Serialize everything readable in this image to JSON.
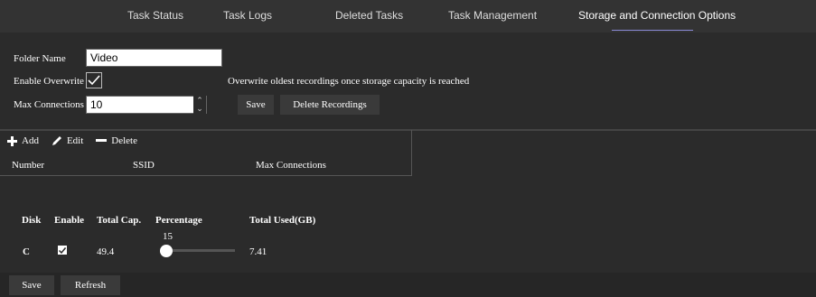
{
  "nav": {
    "tabs": [
      {
        "label": "Task Status"
      },
      {
        "label": "Task Logs"
      },
      {
        "label": "Deleted Tasks"
      },
      {
        "label": "Task Management"
      },
      {
        "label": "Storage and Connection Options",
        "active": true
      }
    ]
  },
  "settings": {
    "folder_name_label": "Folder Name",
    "folder_name_value": "Video",
    "enable_overwrite_label": "Enable Overwrite",
    "enable_overwrite_checked": true,
    "overwrite_note": "Overwrite oldest recordings once storage capacity is reached",
    "max_connections_label": "Max Connections",
    "max_connections_value": "10",
    "save_label": "Save",
    "delete_recordings_label": "Delete Recordings"
  },
  "connections_table": {
    "toolbar": {
      "add": "Add",
      "edit": "Edit",
      "delete": "Delete"
    },
    "headers": [
      "Number",
      "SSID",
      "Max Connections"
    ]
  },
  "disk_table": {
    "headers": [
      "Disk",
      "Enable",
      "Total Cap.",
      "Percentage",
      "Total Used(GB)"
    ],
    "rows": [
      {
        "disk": "C",
        "enabled": true,
        "total_cap": "49.4",
        "percentage": "15",
        "total_used": "7.41"
      }
    ]
  },
  "footer": {
    "save_label": "Save",
    "refresh_label": "Refresh"
  },
  "colors": {
    "background": "#2b2b2b",
    "active_tab_underline": "#8a8ad6"
  }
}
